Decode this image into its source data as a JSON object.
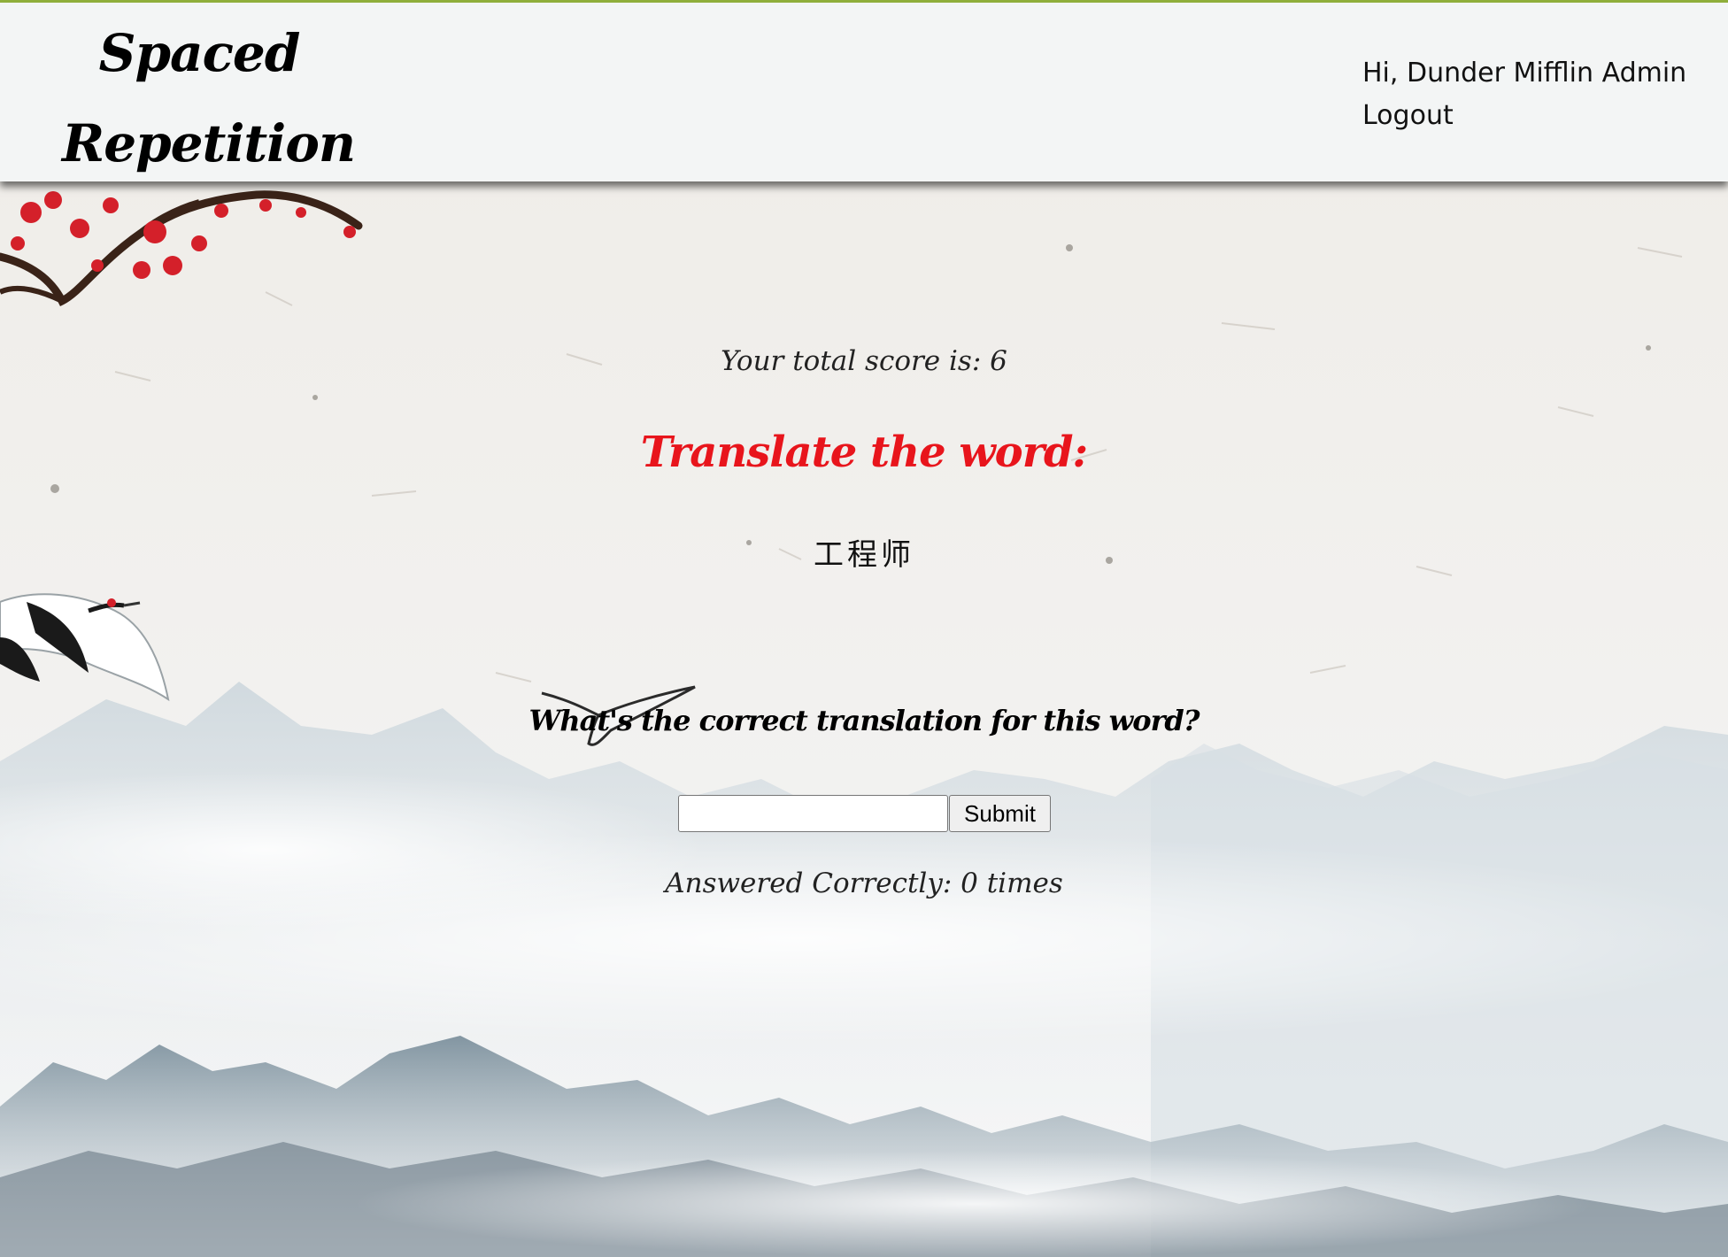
{
  "header": {
    "logo_line1": "Spaced",
    "logo_line2": "Repetition",
    "greeting": "Hi, Dunder Mifflin Admin",
    "logout_label": "Logout"
  },
  "main": {
    "score_text": "Your total score is: 6",
    "heading": "Translate the word:",
    "word": "工程师",
    "question": "What's the correct translation for this word?",
    "answer_value": "",
    "submit_label": "Submit",
    "correct_count_text": "Answered Correctly: 0 times"
  },
  "colors": {
    "header_bg": "#f3f5f5",
    "header_top_border": "#8fae3b",
    "heading_red": "#e8151c",
    "page_bg": "#efedea"
  },
  "icons": {
    "background": "ink-wash-mountains-painting",
    "blossom": "plum-blossom-branch-icon",
    "crane": "flying-crane-icon",
    "bird": "small-bird-icon"
  }
}
